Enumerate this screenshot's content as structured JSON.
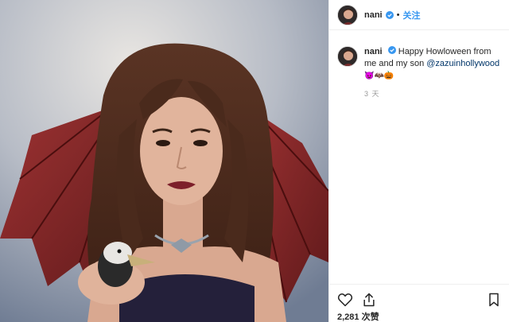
{
  "header": {
    "username": "nani",
    "dot": "•",
    "follow_label": "关注",
    "verified_icon": "verified-badge-icon"
  },
  "caption": {
    "username": "nani",
    "text": "Happy Howloween from me and my son",
    "mention": "@zazuinhollywood",
    "emojis": "😈🦇🎃",
    "timestamp": "3 天"
  },
  "actions": {
    "like_icon": "heart-icon",
    "share_icon": "share-icon",
    "save_icon": "bookmark-icon",
    "likes": "2,281 次赞"
  },
  "colors": {
    "accent": "#3897f0",
    "mention": "#003569",
    "verified": "#3897f0",
    "timestamp": "#999999"
  }
}
